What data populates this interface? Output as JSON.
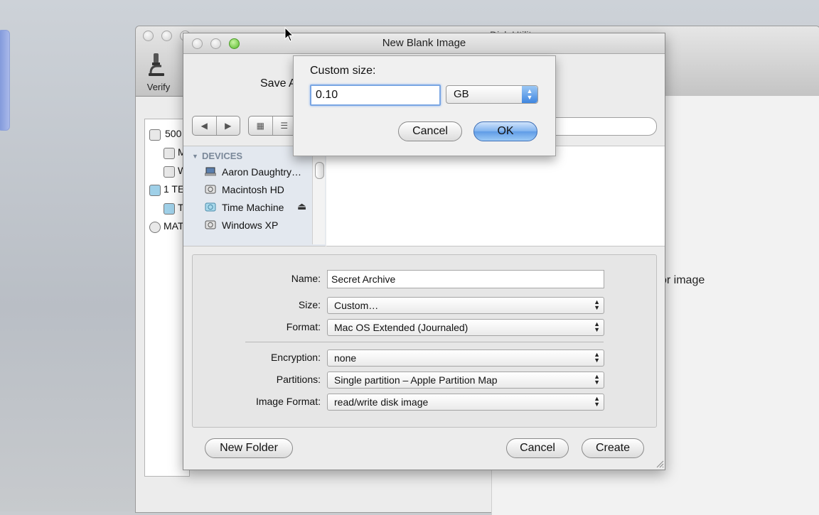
{
  "disk_utility": {
    "title": "Disk Utility",
    "toolbar": {
      "verify_label": "Verify"
    },
    "sidebar_items": [
      "500",
      "M",
      "W",
      "1 TE",
      "T",
      "MAT"
    ],
    "right_fragment": "or image"
  },
  "new_image_sheet": {
    "title": "New Blank Image",
    "save_as_label": "Save A",
    "nav_back_icon": "◀",
    "nav_forward_icon": "▶",
    "view_icon_mode": "▦",
    "view_list_mode": "☰",
    "sidebar": {
      "section": "DEVICES",
      "items": [
        {
          "label": "Aaron Daughtry…",
          "icon": "laptop-icon"
        },
        {
          "label": "Macintosh HD",
          "icon": "hard-drive-icon"
        },
        {
          "label": "Time Machine",
          "icon": "time-machine-drive-icon",
          "eject": "⏏"
        },
        {
          "label": "Windows XP",
          "icon": "hard-drive-icon"
        }
      ]
    },
    "form": {
      "name_label": "Name:",
      "name_value": "Secret Archive",
      "size_label": "Size:",
      "size_value": "Custom…",
      "format_label": "Format:",
      "format_value": "Mac OS Extended (Journaled)",
      "encryption_label": "Encryption:",
      "encryption_value": "none",
      "partitions_label": "Partitions:",
      "partitions_value": "Single partition – Apple Partition Map",
      "image_format_label": "Image Format:",
      "image_format_value": "read/write disk image"
    },
    "buttons": {
      "new_folder": "New Folder",
      "cancel": "Cancel",
      "create": "Create"
    }
  },
  "custom_size_popover": {
    "title": "Custom size:",
    "size_value": "0.10",
    "unit": "GB",
    "cancel": "Cancel",
    "ok": "OK"
  },
  "colors": {
    "accent_blue": "#5f9be6",
    "focus_ring": "#7aa6e3",
    "sidebar_bg": "#e3e8ef"
  }
}
